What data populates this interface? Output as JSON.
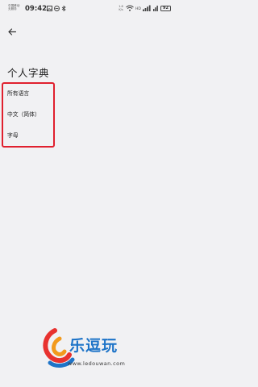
{
  "status_bar": {
    "carrier_line1": "中国移动",
    "carrier_line2": "无服务",
    "time": "09:42",
    "speed_value": "1.6",
    "speed_unit": "K/s",
    "battery": "92",
    "icons": [
      "image-icon",
      "dnd-icon",
      "bluetooth-icon",
      "wifi-icon",
      "hd-icon",
      "signal-icon",
      "battery-icon"
    ]
  },
  "header": {
    "back_icon": "back-arrow-icon",
    "title": "个人字典"
  },
  "dictionary_list": {
    "items": [
      {
        "label": "所有语言"
      },
      {
        "label": "中文（简体）"
      },
      {
        "label": "字母"
      }
    ]
  },
  "annotation": {
    "highlight_color": "#e0202e"
  },
  "watermark": {
    "brand": "乐逗玩",
    "url": "www.ledouwan.com",
    "colors": {
      "blue": "#1e74c8",
      "red": "#e8322f",
      "orange": "#f29a1d"
    }
  }
}
